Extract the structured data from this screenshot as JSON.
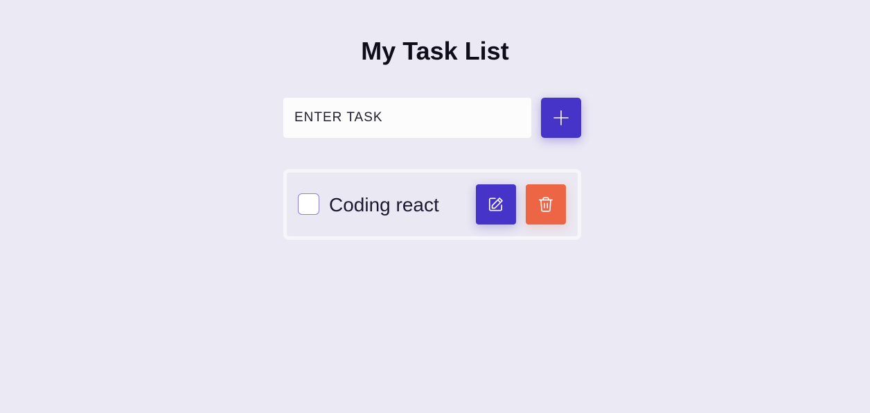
{
  "page": {
    "title": "My Task List"
  },
  "form": {
    "input_placeholder": "ENTER TASK",
    "input_value": "",
    "add_icon": "plus-icon"
  },
  "tasks": [
    {
      "text": "Coding react",
      "completed": false,
      "edit_icon": "pencil-square-icon",
      "delete_icon": "trash-icon"
    }
  ],
  "colors": {
    "background": "#ebe9f3",
    "primary": "#4634c8",
    "danger": "#ec6545",
    "input_background": "#fcfcfd"
  }
}
